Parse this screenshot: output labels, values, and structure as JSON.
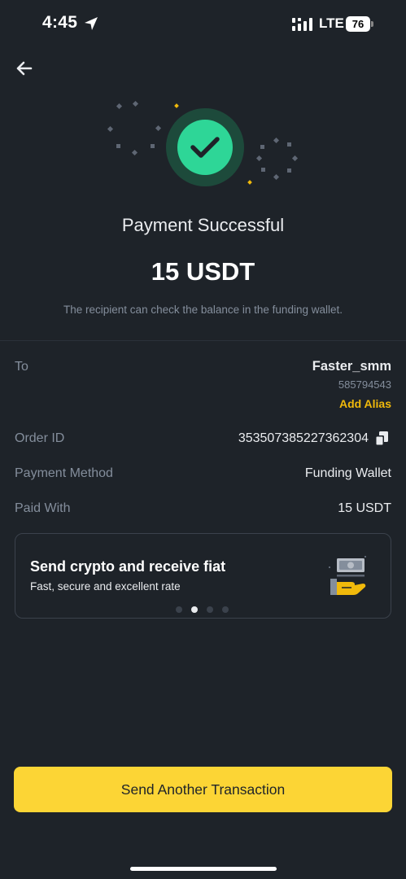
{
  "status_bar": {
    "time": "4:45",
    "network": "LTE",
    "battery": "76"
  },
  "header": {
    "back_icon": "arrow-left-icon"
  },
  "result": {
    "title": "Payment Successful",
    "amount": "15 USDT",
    "subtitle": "The recipient can check the balance in the funding wallet.",
    "status_color": "#2ed697"
  },
  "details": {
    "to_label": "To",
    "recipient_name": "Faster_smm",
    "recipient_id": "585794543",
    "add_alias": "Add Alias",
    "order_id_label": "Order ID",
    "order_id": "353507385227362304",
    "payment_method_label": "Payment Method",
    "payment_method": "Funding Wallet",
    "paid_with_label": "Paid With",
    "paid_with": "15 USDT"
  },
  "promo": {
    "title": "Send crypto and receive fiat",
    "subtitle": "Fast, secure and excellent rate",
    "page_count": 4,
    "active_page": 2
  },
  "actions": {
    "primary": "Send Another Transaction"
  },
  "colors": {
    "accent": "#fcd535",
    "background": "#1e2329",
    "alias": "#f0b90b"
  }
}
